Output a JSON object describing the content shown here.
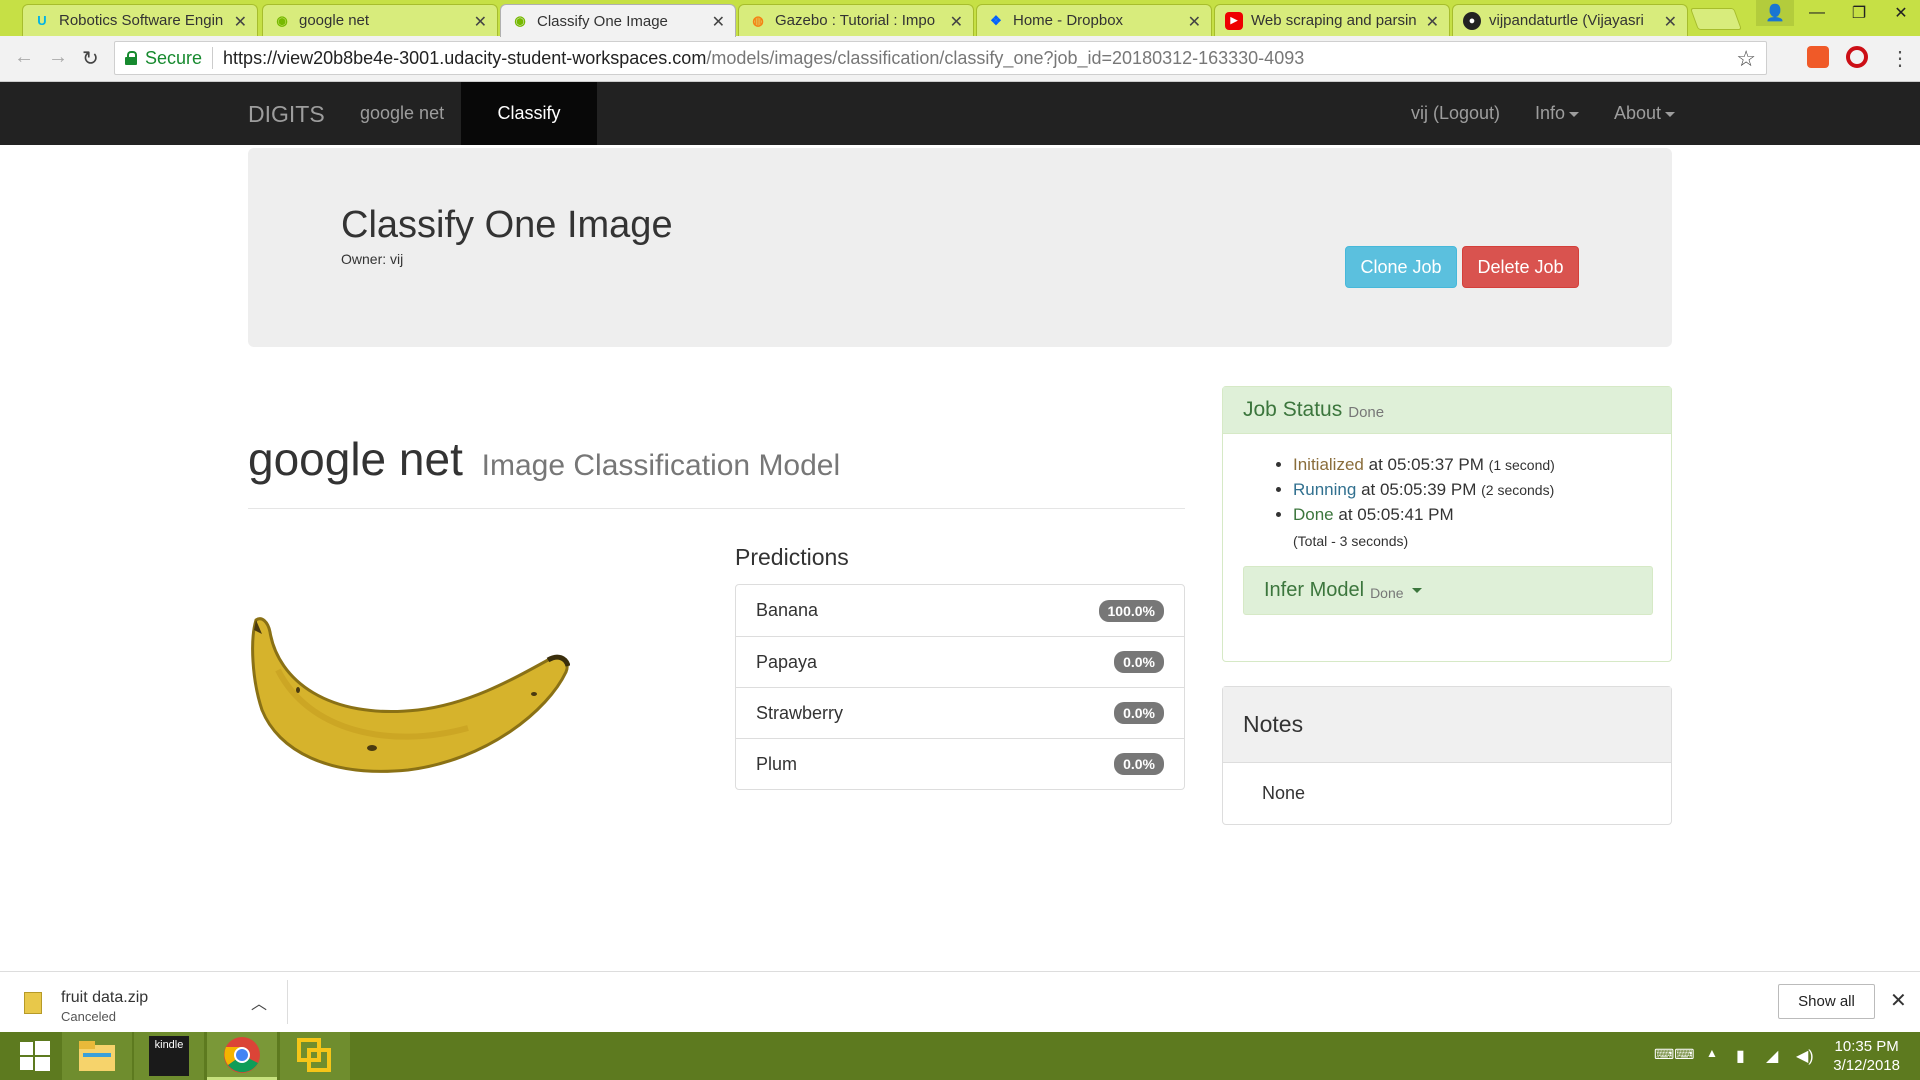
{
  "browser": {
    "tabs": [
      {
        "title": "Robotics Software Engin",
        "icon": "udacity-icon",
        "active": false
      },
      {
        "title": "google net",
        "icon": "nvidia-icon",
        "active": false
      },
      {
        "title": "Classify One Image",
        "icon": "nvidia-icon",
        "active": true
      },
      {
        "title": "Gazebo : Tutorial : Impo",
        "icon": "gazebo-icon",
        "active": false
      },
      {
        "title": "Home - Dropbox",
        "icon": "dropbox-icon",
        "active": false
      },
      {
        "title": "Web scraping and parsin",
        "icon": "youtube-icon",
        "active": false
      },
      {
        "title": "vijpandaturtle (Vijayasri",
        "icon": "github-icon",
        "active": false
      }
    ],
    "secure_label": "Secure",
    "url_host": "https://view20b8be4e-3001.udacity-student-workspaces.com",
    "url_path": "/models/images/classification/classify_one?job_id=20180312-163330-4093"
  },
  "navbar": {
    "brand": "DIGITS",
    "items": [
      "google net",
      "Classify One"
    ],
    "user": "vij (Logout)",
    "info": "Info",
    "about": "About"
  },
  "job": {
    "title": "Classify One Image",
    "owner": "Owner: vij",
    "clone_label": "Clone Job",
    "delete_label": "Delete Job"
  },
  "model": {
    "name": "google net",
    "type": "Image Classification Model"
  },
  "predictions": {
    "title": "Predictions",
    "items": [
      {
        "label": "Banana",
        "value": "100.0%"
      },
      {
        "label": "Papaya",
        "value": "0.0%"
      },
      {
        "label": "Strawberry",
        "value": "0.0%"
      },
      {
        "label": "Plum",
        "value": "0.0%"
      }
    ]
  },
  "status": {
    "title": "Job Status",
    "state": "Done",
    "events": [
      {
        "state": "Initialized",
        "at": "at 05:05:37 PM",
        "duration": "(1 second)"
      },
      {
        "state": "Running",
        "at": "at 05:05:39 PM",
        "duration": "(2 seconds)"
      },
      {
        "state": "Done",
        "at": "at 05:05:41 PM",
        "duration": ""
      }
    ],
    "total": "(Total - 3 seconds)",
    "infer_title": "Infer Model",
    "infer_state": "Done"
  },
  "notes": {
    "title": "Notes",
    "body": "None"
  },
  "download": {
    "filename": "fruit data.zip",
    "status": "Canceled",
    "show_all": "Show all"
  },
  "taskbar": {
    "time": "10:35 PM",
    "date": "3/12/2018",
    "kindle_label": "kindle"
  },
  "colors": {
    "tabbar": "#c6e045",
    "navbar": "#222222",
    "info": "#5bc0de",
    "danger": "#d9534f",
    "success_bg": "#dff0d8",
    "taskbar": "#5d7a1f"
  }
}
